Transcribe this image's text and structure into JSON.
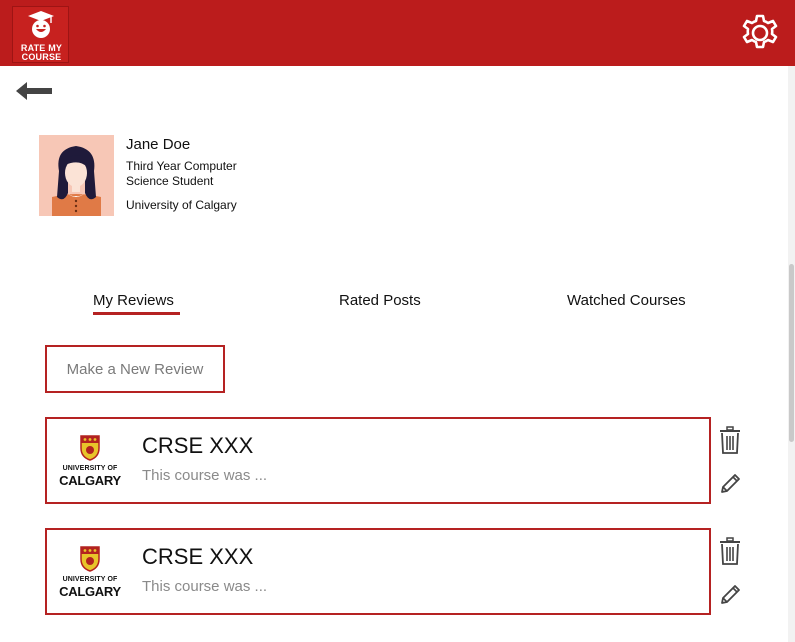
{
  "header": {
    "logo_line1": "RATE MY",
    "logo_line2": "COURSE",
    "brand_color": "#bb1c1c",
    "settings_icon": "gear-icon"
  },
  "nav": {
    "back_icon": "arrow-left-icon"
  },
  "profile": {
    "name": "Jane Doe",
    "description": "Third Year Computer Science Student",
    "university": "University of Calgary"
  },
  "tabs": [
    {
      "label": "My Reviews",
      "active": true
    },
    {
      "label": "Rated Posts",
      "active": false
    },
    {
      "label": "Watched Courses",
      "active": false
    }
  ],
  "new_review_label": "Make a New Review",
  "reviews": [
    {
      "logo_line1": "UNIVERSITY OF",
      "logo_line2": "CALGARY",
      "course": "CRSE XXX",
      "snippet": "This course was ..."
    },
    {
      "logo_line1": "UNIVERSITY OF",
      "logo_line2": "CALGARY",
      "course": "CRSE XXX",
      "snippet": "This course was ..."
    }
  ],
  "accent_color": "#b52222"
}
